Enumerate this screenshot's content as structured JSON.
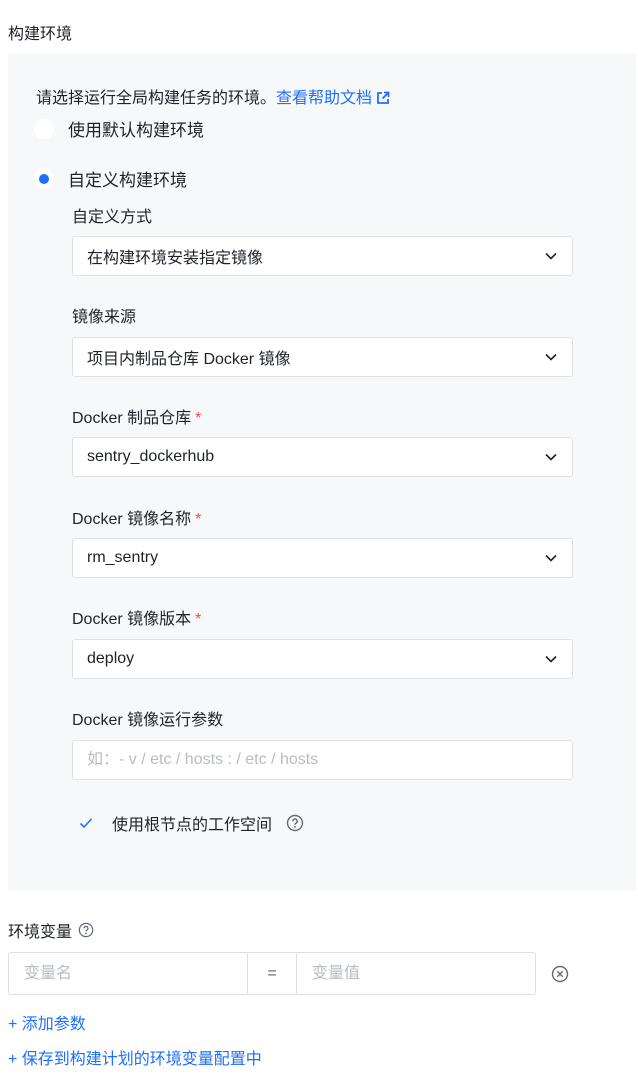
{
  "section_title": "构建环境",
  "intro": {
    "text": "请选择运行全局构建任务的环境。",
    "help_link": "查看帮助文档"
  },
  "radios": {
    "default_label": "使用默认构建环境",
    "custom_label": "自定义构建环境",
    "selected": "custom"
  },
  "custom": {
    "method_label": "自定义方式",
    "method_value": "在构建环境安装指定镜像",
    "source_label": "镜像来源",
    "source_value": "项目内制品仓库 Docker 镜像",
    "repo_label": "Docker 制品仓库",
    "repo_value": "sentry_dockerhub",
    "image_name_label": "Docker 镜像名称",
    "image_name_value": "rm_sentry",
    "image_version_label": "Docker 镜像版本",
    "image_version_value": "deploy",
    "run_args_label": "Docker 镜像运行参数",
    "run_args_placeholder": "如：- v / etc / hosts : / etc / hosts",
    "required_mark": "*",
    "use_root_workspace_label": "使用根节点的工作空间",
    "use_root_workspace_checked": true
  },
  "env_vars": {
    "title": "环境变量",
    "key_placeholder": "变量名",
    "equals": "=",
    "value_placeholder": "变量值",
    "add_param": "+ 添加参数",
    "save_to_plan": "+ 保存到构建计划的环境变量配置中"
  },
  "colors": {
    "accent": "#1e6fff",
    "required": "#f54a45",
    "panel_bg": "#f7f8fa",
    "border": "#dee0e3"
  }
}
